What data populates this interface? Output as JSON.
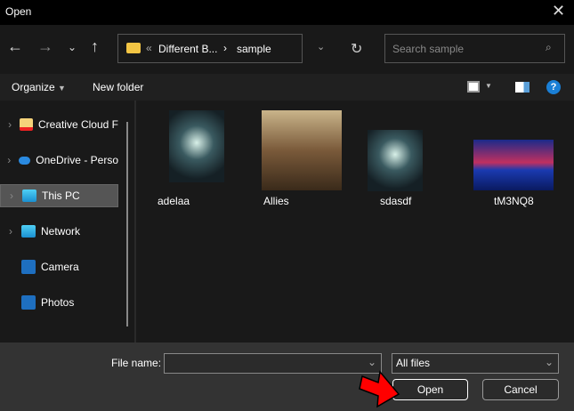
{
  "window": {
    "title": "Open"
  },
  "nav": {
    "breadcrumb": [
      "Different B...",
      "sample"
    ],
    "search_placeholder": "Search sample"
  },
  "toolbar": {
    "organize": "Organize",
    "new_folder": "New folder"
  },
  "sidebar": {
    "items": [
      {
        "label": "Creative Cloud F"
      },
      {
        "label": "OneDrive - Perso"
      },
      {
        "label": "This PC"
      },
      {
        "label": "Network"
      },
      {
        "label": "Camera"
      },
      {
        "label": "Photos"
      }
    ]
  },
  "files": [
    {
      "name": "adelaa"
    },
    {
      "name": "Allies"
    },
    {
      "name": "sdasdf"
    },
    {
      "name": "tM3NQ8"
    }
  ],
  "footer": {
    "file_name_label": "File name:",
    "file_name_value": "",
    "file_type": "All files",
    "open": "Open",
    "cancel": "Cancel"
  }
}
